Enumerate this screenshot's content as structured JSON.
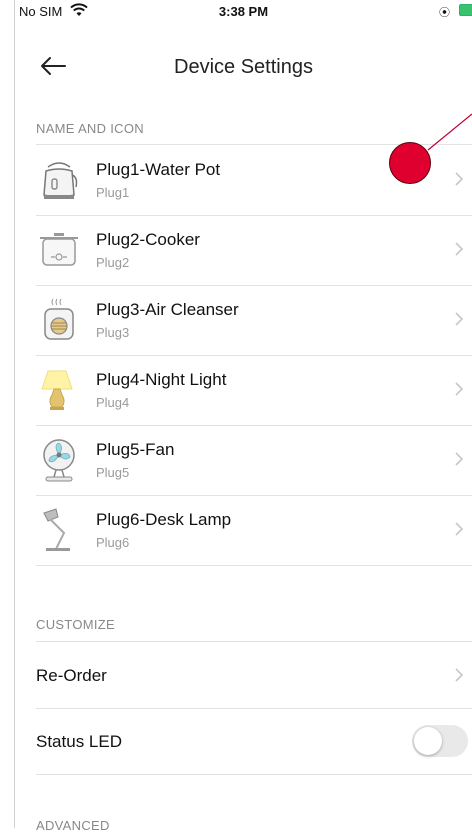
{
  "status_bar": {
    "carrier": "No SIM",
    "time": "3:38 PM"
  },
  "nav": {
    "title": "Device Settings"
  },
  "sections": {
    "name_and_icon": "NAME AND ICON",
    "customize": "CUSTOMIZE",
    "advanced": "ADVANCED"
  },
  "plugs": [
    {
      "name": "Plug1-Water Pot",
      "sub": "Plug1",
      "icon": "water-pot-icon"
    },
    {
      "name": "Plug2-Cooker",
      "sub": "Plug2",
      "icon": "cooker-icon"
    },
    {
      "name": "Plug3-Air Cleanser",
      "sub": "Plug3",
      "icon": "air-cleanser-icon"
    },
    {
      "name": "Plug4-Night Light",
      "sub": "Plug4",
      "icon": "night-light-icon"
    },
    {
      "name": "Plug5-Fan",
      "sub": "Plug5",
      "icon": "fan-icon"
    },
    {
      "name": "Plug6-Desk Lamp",
      "sub": "Plug6",
      "icon": "desk-lamp-icon"
    }
  ],
  "customize": {
    "reorder_label": "Re-Order",
    "status_led_label": "Status LED",
    "status_led_on": false
  },
  "colors": {
    "marker": "#e00030",
    "toggle_off": "#e9e9ea"
  }
}
